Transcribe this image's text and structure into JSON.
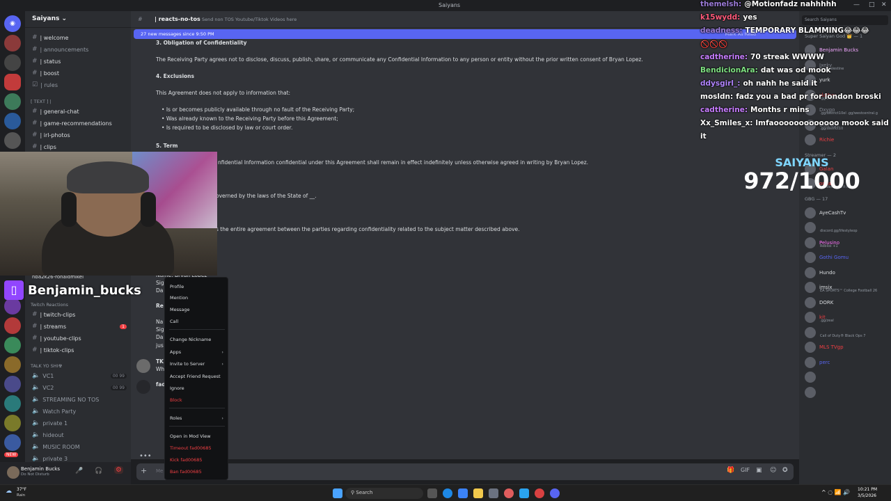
{
  "titlebar": {
    "title": "Saiyans"
  },
  "server": {
    "name": "Saiyans"
  },
  "sidebar": {
    "channels_top": [
      {
        "label": "| welcome"
      },
      {
        "label": "| announcements"
      },
      {
        "label": "| status"
      },
      {
        "label": "| boost"
      },
      {
        "label": "| rules"
      }
    ],
    "category_text": "[ Text ] |",
    "channels_text": [
      {
        "label": "| general-chat"
      },
      {
        "label": "| game-recommendations"
      },
      {
        "label": "| irl-photos"
      },
      {
        "label": "| clips"
      }
    ],
    "dm_peek": "nba2k26-ronaldmikel",
    "category_twitch": "Twitch Reactions",
    "channels_twitch": [
      {
        "label": "| twitch-clips"
      },
      {
        "label": "| streams",
        "badge": "1"
      },
      {
        "label": "| youtube-clips"
      },
      {
        "label": "| tiktok-clips"
      }
    ],
    "category_voice": "TALK YO SHI☢",
    "voice_channels": [
      {
        "label": "VC1",
        "count": "00 99"
      },
      {
        "label": "VC2",
        "count": "00 99"
      },
      {
        "label": "STREAMING NO TOS"
      },
      {
        "label": "Watch Party"
      },
      {
        "label": "private 1"
      },
      {
        "label": "hideout"
      },
      {
        "label": "MUSIC ROOM"
      },
      {
        "label": "private 3"
      }
    ]
  },
  "user": {
    "name": "Benjamin Bucks",
    "status": "Do Not Disturb"
  },
  "rail_badges": [
    "•",
    "NEW"
  ],
  "chat_header": {
    "channel": "| reacts-no-tos",
    "topic": "Send non TOS Youtube/Tiktok Videos here"
  },
  "new_messages_bar": {
    "text": "27 new messages since 9:50 PM",
    "action": "Mark As Read"
  },
  "document": {
    "s3_title": "3. Obligation of Confidentiality",
    "s3_body": "The Receiving Party agrees not to disclose, discuss, publish, share, or communicate any Confidential Information to any person or entity without the prior written consent of Bryan Lopez.",
    "s4_title": "4. Exclusions",
    "s4_body": "This Agreement does not apply to information that:",
    "s4_items": [
      "Is or becomes publicly available through no fault of the Receiving Party;",
      "Was already known to the Receiving Party before this Agreement;",
      "Is required to be disclosed by law or court order."
    ],
    "s5_title": "5. Term",
    "s5_body_fragment": "nfidential Information confidential under this Agreement shall remain in effect indefinitely unless otherwise agreed in writing by Bryan Lopez.",
    "s6_fragment": "overned by the laws of the State of __.",
    "s7_fragment": "s the entire agreement between the parties regarding confidentiality related to the subject matter described above.",
    "sig_name": "Name: Bryan Lopez",
    "sig_frag1": "Sig",
    "sig_frag2": "Da",
    "sig_frag3": "Re",
    "sig_frag4": "Na",
    "sig_frag5": "Sig",
    "sig_frag6": "Da",
    "sig_frag7": "jus",
    "msg_frag1": "TK",
    "msg_frag2": "Wh",
    "msg_frag3": "fad"
  },
  "composer": {
    "placeholder": "Me"
  },
  "context_menu": {
    "items": [
      "Profile",
      "Mention",
      "Message",
      "Call",
      "Change Nickname",
      "Apps",
      "Invite to Server",
      "Accept Friend Request",
      "Ignore",
      "Block",
      "Roles",
      "Open in Mod View",
      "Timeout fad00685",
      "Kick fad00685",
      "Ban fad00685"
    ]
  },
  "twitch_overlay": {
    "name": "Benjamin_bucks"
  },
  "stream_chat": [
    {
      "user": "themelsh:",
      "msg": "@Motionfadz nahhhhh",
      "color": "#9b7bd8"
    },
    {
      "user": "k15wydd:",
      "msg": "yes",
      "color": "#ff5a7a"
    },
    {
      "user": "deadness:",
      "msg": "TEMPORARY BLAMMING😂😂😂",
      "color": "#9b7bd8"
    },
    {
      "user": "",
      "msg": "🚫🚫🚫",
      "color": "#ffffff"
    },
    {
      "user": "cadtherine:",
      "msg": "70 streak WWWW",
      "color": "#c77dff"
    },
    {
      "user": "BendicionAra:",
      "msg": "dat was od mook",
      "color": "#7ee081"
    },
    {
      "user": "ddysgirl_:",
      "msg": "oh nahh he said it",
      "color": "#b184ff"
    },
    {
      "user": "mosldn:",
      "msg": "fadz you a bad pr for london broski",
      "color": "#ffffff"
    },
    {
      "user": "cadtherine:",
      "msg": "Months r mins",
      "color": "#c77dff"
    },
    {
      "user": "Xx_Smiles_x:",
      "msg": "lmfaooooooooooooo moook said",
      "color": "#ffffff"
    },
    {
      "user": "",
      "msg": "it",
      "color": "#ffffff"
    }
  ],
  "goal": {
    "label": "SAIYANS",
    "value": "972/1000",
    "label_color": "#7fd6ff"
  },
  "members": {
    "search_placeholder": "Search Saiyans",
    "list": [
      {
        "name": "Super Saiyan God 👑 — 1",
        "cat": true
      },
      {
        "name": "Benjamin Bucks",
        "color": "#f2a7ff"
      },
      {
        "name": "Jxeky",
        "sub": "free palestine"
      },
      {
        "name": "yurk",
        "color": "#dbdee1"
      },
      {
        "name": "slattyy",
        "sub": ".gg/district10el",
        "color": "#f23f43"
      },
      {
        "name": "Dxygo",
        "sub": ".gg/district10el .gg/westcentral.g"
      },
      {
        "name": "Outrage",
        "sub": ".gg/district10"
      },
      {
        "name": "Richie",
        "color": "#f23f43"
      },
      {
        "name": "Streamer — 2",
        "cat": true
      },
      {
        "name": "Galan",
        "color": "#f23f43"
      },
      {
        "name": "oneal",
        "sub": "i understand it now",
        "color": "#f23f43"
      },
      {
        "name": "GBG — 17",
        "cat": true
      },
      {
        "name": "AyeCashTv",
        "color": "#dbdee1"
      },
      {
        "name": "",
        "sub": "discord.gg/lifestyleop"
      },
      {
        "name": "Pelusino",
        "sub": "Roblox +1",
        "color": "#ff73fa"
      },
      {
        "name": "Gothi Gomu",
        "color": "#5865f2"
      },
      {
        "name": "Hundo",
        "color": "#dbdee1"
      },
      {
        "name": "imsix",
        "sub": "EA SPORTS™ College Football 26",
        "color": "#dbdee1"
      },
      {
        "name": "DORK",
        "color": "#dbdee1"
      },
      {
        "name": "kit",
        "sub": ".gg/zeal",
        "color": "#f23f43"
      },
      {
        "name": "",
        "sub": "Call of Duty® Black Ops 7"
      },
      {
        "name": "MLS TVgp",
        "color": "#f23f43"
      },
      {
        "name": "perc",
        "color": "#5865f2"
      },
      {
        "name": "",
        "color": "#dbdee1"
      },
      {
        "name": "",
        "color": "#dbdee1"
      }
    ]
  },
  "taskbar": {
    "weather_temp": "37°F",
    "weather_desc": "Rain",
    "search": "Search",
    "time": "10:21 PM",
    "date": "3/5/2026"
  }
}
